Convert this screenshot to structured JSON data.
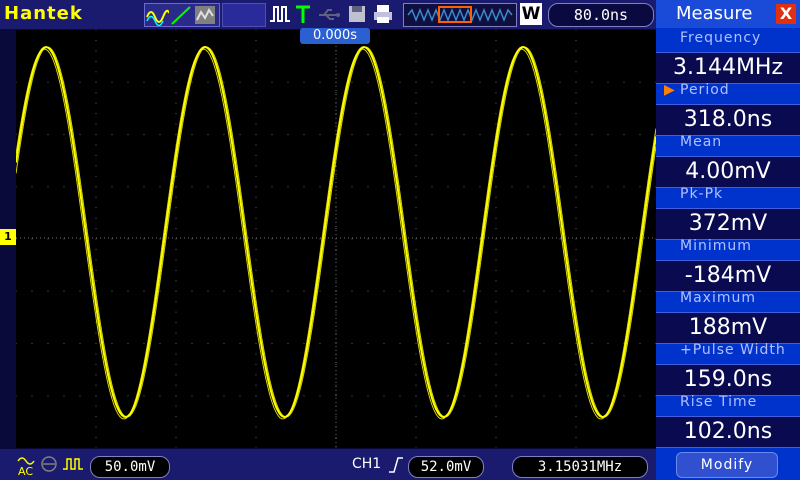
{
  "header": {
    "brand": "Hantek",
    "time_per_div": "80.0ns",
    "mode_letter": "W"
  },
  "screen": {
    "trigger_position": "0.000s",
    "channel_marker": "1"
  },
  "measure": {
    "title": "Measure",
    "close_label": "X",
    "items": [
      {
        "label": "Frequency",
        "value": "3.144MHz",
        "active": false
      },
      {
        "label": "Period",
        "value": "318.0ns",
        "active": true
      },
      {
        "label": "Mean",
        "value": "4.00mV",
        "active": false
      },
      {
        "label": "Pk-Pk",
        "value": "372mV",
        "active": false
      },
      {
        "label": "Minimum",
        "value": "-184mV",
        "active": false
      },
      {
        "label": "Maximum",
        "value": "188mV",
        "active": false
      },
      {
        "label": "+Pulse Width",
        "value": "159.0ns",
        "active": false
      },
      {
        "label": "Rise Time",
        "value": "102.0ns",
        "active": false
      }
    ],
    "modify_label": "Modify"
  },
  "footer": {
    "ch1_scale": "50.0mV",
    "trigger_source": "CH1",
    "trigger_level": "52.0mV",
    "frequency_counter": "3.15031MHz"
  },
  "colors": {
    "trace": "#ffff00",
    "background": "#000000",
    "panel": "#0033cc"
  }
}
